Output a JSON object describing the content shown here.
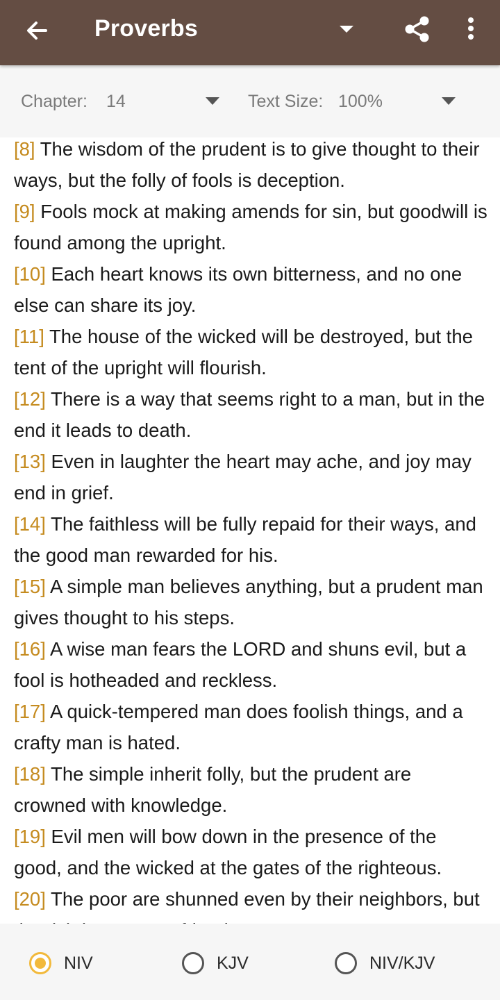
{
  "appbar": {
    "title": "Proverbs",
    "back_icon": "arrow-left-icon",
    "dropdown_icon": "caret-down-icon",
    "share_icon": "share-icon",
    "more_icon": "more-vertical-icon",
    "background": "#644d43"
  },
  "controls": {
    "chapter_label": "Chapter:",
    "chapter_value": "14",
    "text_size_label": "Text Size:",
    "text_size_value": "100%"
  },
  "verses": [
    {
      "num": "[8]",
      "text": " The wisdom of the prudent is to give thought to their ways, but the folly of fools is deception."
    },
    {
      "num": "[9]",
      "text": " Fools mock at making amends for sin, but goodwill is found among the upright."
    },
    {
      "num": "[10]",
      "text": " Each heart knows its own bitterness, and no one else can share its joy."
    },
    {
      "num": "[11]",
      "text": " The house of the wicked will be destroyed, but the tent of the upright will flourish."
    },
    {
      "num": "[12]",
      "text": " There is a way that seems right to a man, but in the end it leads to death."
    },
    {
      "num": "[13]",
      "text": " Even in laughter the heart may ache, and joy may end in grief."
    },
    {
      "num": "[14]",
      "text": " The faithless will be fully repaid for their ways, and the good man rewarded for his."
    },
    {
      "num": "[15]",
      "text": " A simple man believes anything, but a prudent man gives thought to his steps."
    },
    {
      "num": "[16]",
      "text": " A wise man fears the LORD and shuns evil, but a fool is hotheaded and reckless."
    },
    {
      "num": "[17]",
      "text": " A quick-tempered man does foolish things, and a crafty man is hated."
    },
    {
      "num": "[18]",
      "text": " The simple inherit folly, but the prudent are crowned with knowledge."
    },
    {
      "num": "[19]",
      "text": " Evil men will bow down in the presence of the good, and the wicked at the gates of the righteous."
    },
    {
      "num": "[20]",
      "text": " The poor are shunned even by their neighbors, but the rich have many friends."
    }
  ],
  "versions": {
    "options": [
      {
        "label": "NIV",
        "selected": true
      },
      {
        "label": "KJV",
        "selected": false
      },
      {
        "label": "NIV/KJV",
        "selected": false
      }
    ]
  },
  "colors": {
    "accent": "#f2b93b",
    "verse_number": "#c58b1f"
  }
}
